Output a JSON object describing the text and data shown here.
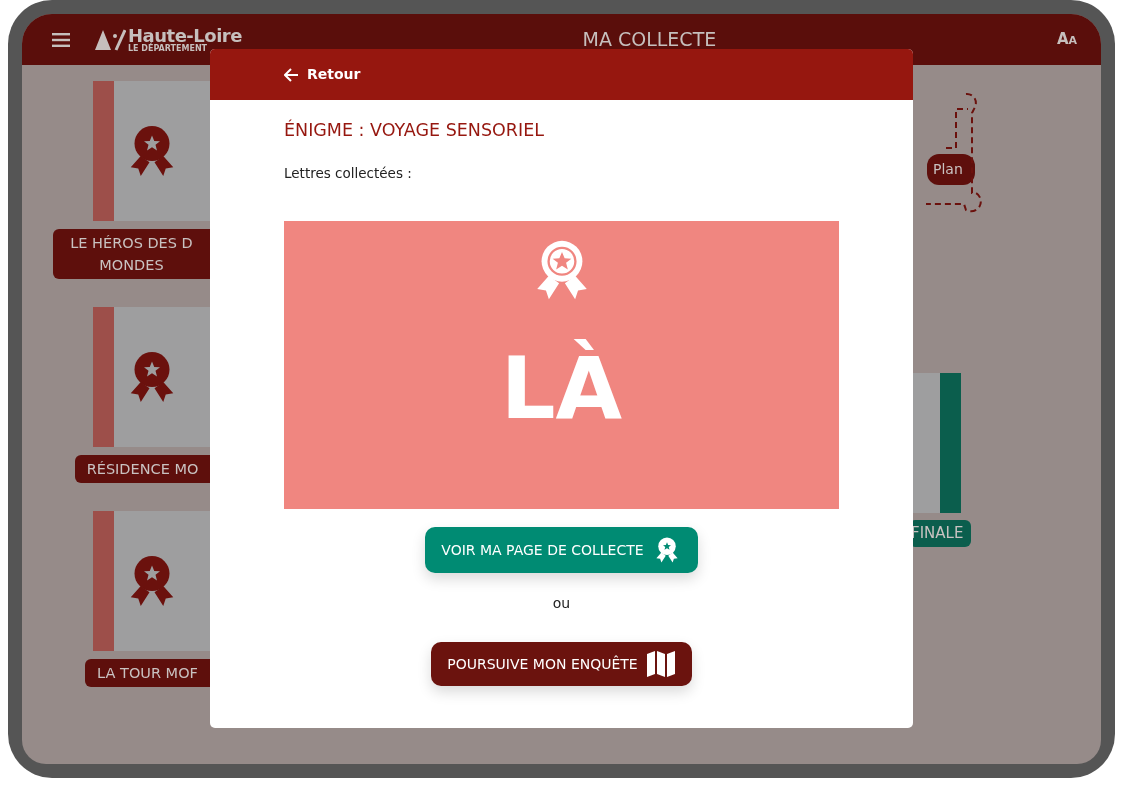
{
  "header": {
    "title": "MA COLLECTE",
    "logo_name": "Haute-Loire",
    "logo_subtitle": "LE DÉPARTEMENT",
    "text_size_button": "Aa"
  },
  "left_cards": [
    {
      "label": "LE HÉROS DES D\nMONDES"
    },
    {
      "label": "RÉSIDENCE MO"
    },
    {
      "label": "LA TOUR MOF"
    }
  ],
  "plan_button": "Plan",
  "right_cards": [
    {
      "label": "FINALE"
    }
  ],
  "modal": {
    "back_link": "Retour",
    "title": "ÉNIGME : VOYAGE SENSORIEL",
    "letters_label": "Lettres collectées :",
    "letters": "LÀ",
    "collect_button": "VOIR MA PAGE DE COLLECTE",
    "separator": "ou",
    "continue_button": "POURSUIVE MON ENQUÊTE"
  }
}
